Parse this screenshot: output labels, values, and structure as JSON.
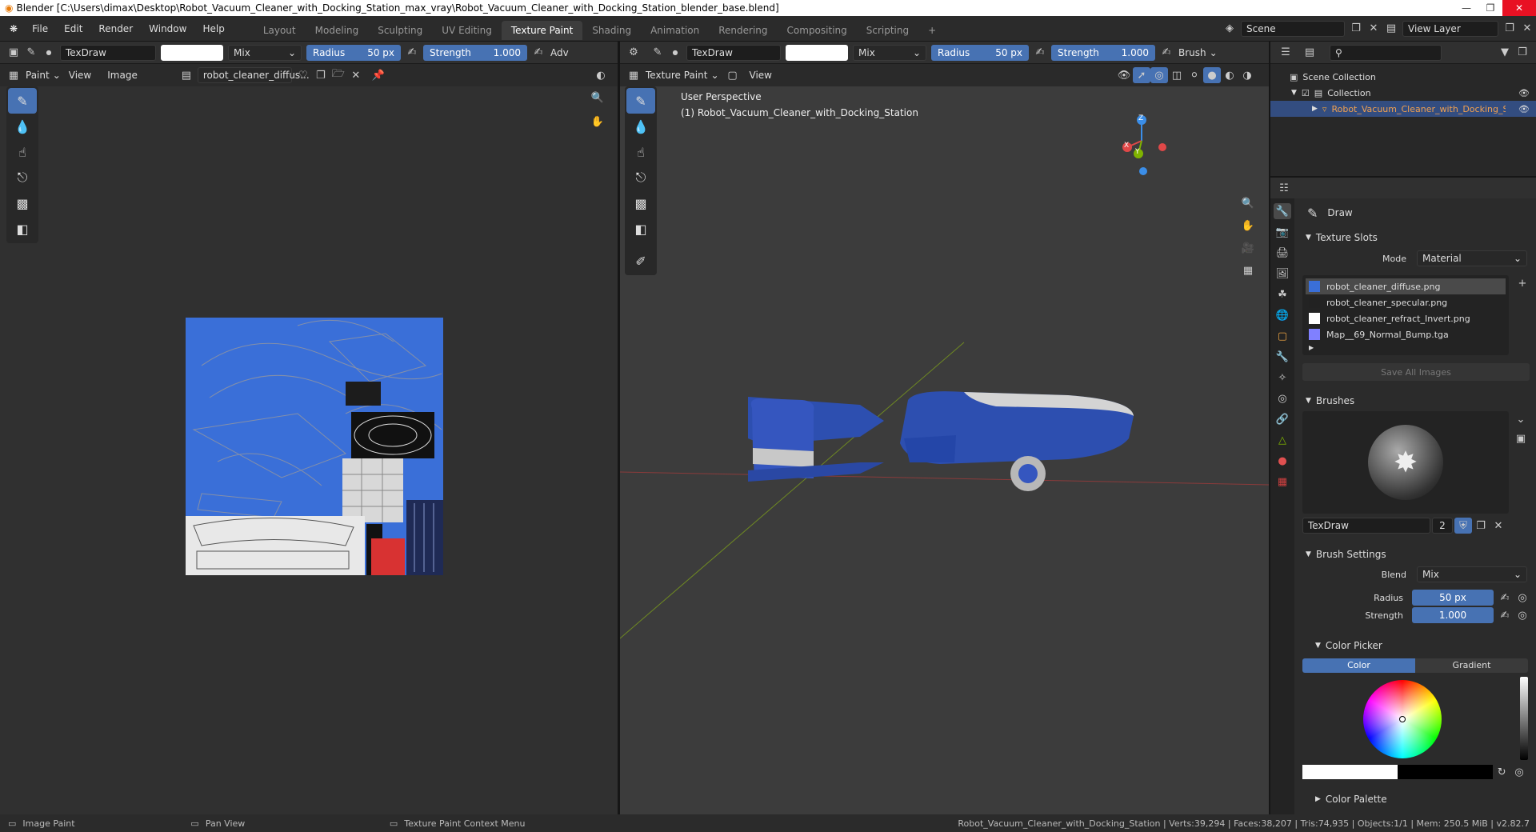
{
  "window": {
    "title": "Blender [C:\\Users\\dimax\\Desktop\\Robot_Vacuum_Cleaner_with_Docking_Station_max_vray\\Robot_Vacuum_Cleaner_with_Docking_Station_blender_base.blend]",
    "controls": [
      "—",
      "❐",
      "✕"
    ]
  },
  "menu": [
    "File",
    "Edit",
    "Render",
    "Window",
    "Help"
  ],
  "workspaces": [
    "Layout",
    "Modeling",
    "Sculpting",
    "UV Editing",
    "Texture Paint",
    "Shading",
    "Animation",
    "Rendering",
    "Compositing",
    "Scripting",
    "+"
  ],
  "active_workspace": "Texture Paint",
  "scene": {
    "label": "Scene",
    "view_layer": "View Layer"
  },
  "image_editor": {
    "brush": "TexDraw",
    "blend": "Mix",
    "radius_label": "Radius",
    "radius": "50 px",
    "strength_label": "Strength",
    "strength": "1.000",
    "adv": "Adv",
    "mode": "Paint",
    "view": "View",
    "image": "Image",
    "image_name": "robot_cleaner_diffus..."
  },
  "viewport": {
    "brush": "TexDraw",
    "blend": "Mix",
    "radius_label": "Radius",
    "radius": "50 px",
    "strength_label": "Strength",
    "strength": "1.000",
    "brush_menu": "Brush",
    "mode": "Texture Paint",
    "view": "View",
    "perspective": "User Perspective",
    "object_label": "(1) Robot_Vacuum_Cleaner_with_Docking_Station",
    "gizmo": {
      "z": "Z",
      "y": "Y",
      "x": "X"
    }
  },
  "outliner": {
    "root": "Scene Collection",
    "collection": "Collection",
    "object": "Robot_Vacuum_Cleaner_with_Docking_Stati"
  },
  "properties": {
    "tool_name": "Draw",
    "texture_slots": {
      "title": "Texture Slots",
      "mode_label": "Mode",
      "mode": "Material",
      "slots": [
        "robot_cleaner_diffuse.png",
        "robot_cleaner_specular.png",
        "robot_cleaner_refract_Invert.png",
        "Map__69_Normal_Bump.tga"
      ],
      "save_all": "Save All Images"
    },
    "brushes": {
      "title": "Brushes",
      "name": "TexDraw",
      "users": "2"
    },
    "brush_settings": {
      "title": "Brush Settings",
      "blend_label": "Blend",
      "blend": "Mix",
      "radius_label": "Radius",
      "radius": "50 px",
      "strength_label": "Strength",
      "strength": "1.000"
    },
    "color_picker": {
      "title": "Color Picker",
      "tab_color": "Color",
      "tab_gradient": "Gradient"
    },
    "color_palette": "Color Palette"
  },
  "status": {
    "left": "Image Paint",
    "mid": "Pan View",
    "ctx": "Texture Paint Context Menu",
    "stats": "Robot_Vacuum_Cleaner_with_Docking_Station | Verts:39,294 | Faces:38,207 | Tris:74,935 | Objects:1/1 | Mem: 250.5 MiB | v2.82.7"
  },
  "colors": {
    "accent": "#4772b3",
    "robot_blue": "#2d4fb0",
    "texture_blue": "#3a6fd8",
    "x_axis": "#e04848",
    "y_axis": "#7fb300",
    "z_axis": "#3b8ee8"
  }
}
